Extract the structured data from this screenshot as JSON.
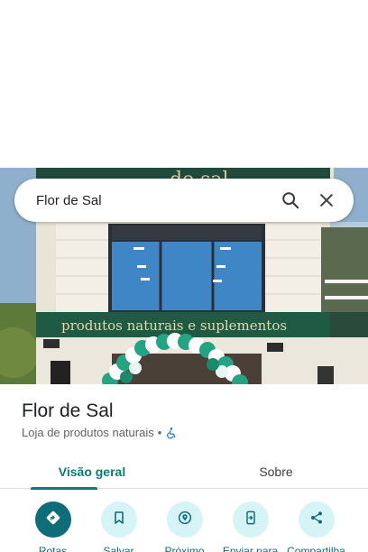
{
  "search": {
    "query": "Flor de Sal"
  },
  "photo": {
    "sign_top_text": "de sal",
    "banner_text": "produtos naturais e suplementos"
  },
  "place": {
    "name": "Flor de Sal",
    "category": "Loja de produtos naturais",
    "separator": "•"
  },
  "tabs": [
    {
      "label": "Visão geral",
      "active": true
    },
    {
      "label": "Sobre",
      "active": false
    }
  ],
  "actions": [
    {
      "label": "Rotas",
      "icon": "directions-icon",
      "primary": true
    },
    {
      "label": "Salvar",
      "icon": "bookmark-icon",
      "primary": false
    },
    {
      "label": "Próximo",
      "icon": "nearby-icon",
      "primary": false
    },
    {
      "label": "Enviar para",
      "icon": "send-to-phone-icon",
      "primary": false
    },
    {
      "label": "Compartilha",
      "icon": "share-icon",
      "primary": false
    }
  ],
  "colors": {
    "accent": "#0b7a7a",
    "action_bg": "#d6f3f6",
    "primary_action": "#0d6e78",
    "a11y_icon": "#1a73e8"
  }
}
